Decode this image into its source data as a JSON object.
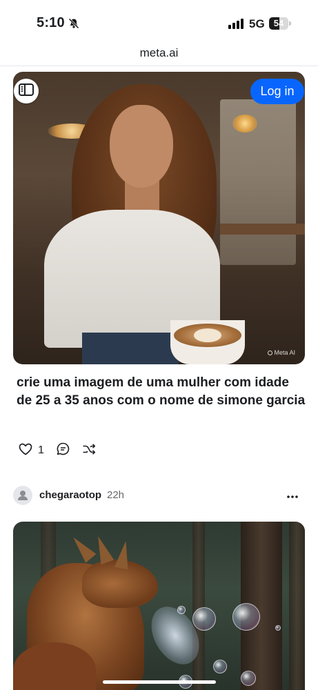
{
  "status_bar": {
    "time": "5:10",
    "network": "5G",
    "battery_level": "54",
    "battery_fraction": 0.54,
    "icons": [
      "bell-slash-icon",
      "signal-bars-icon",
      "battery-icon"
    ]
  },
  "browser": {
    "url": "meta.ai"
  },
  "header": {
    "login_label": "Log in",
    "sidebar_icon": "sidebar-toggle-icon"
  },
  "post1": {
    "watermark": "Meta AI",
    "caption": "crie uma imagem de uma mulher com idade de 25 a 35 anos com o nome de simone garcia",
    "like_count": "1",
    "icons": [
      "heart-icon",
      "comment-icon",
      "remix-icon"
    ]
  },
  "post2": {
    "author": "chegaraotop",
    "time_ago": "22h",
    "icons": [
      "avatar-icon",
      "more-icon"
    ]
  },
  "colors": {
    "primary": "#0866ff",
    "text": "#1c1e21",
    "secondary_text": "#65676b"
  }
}
